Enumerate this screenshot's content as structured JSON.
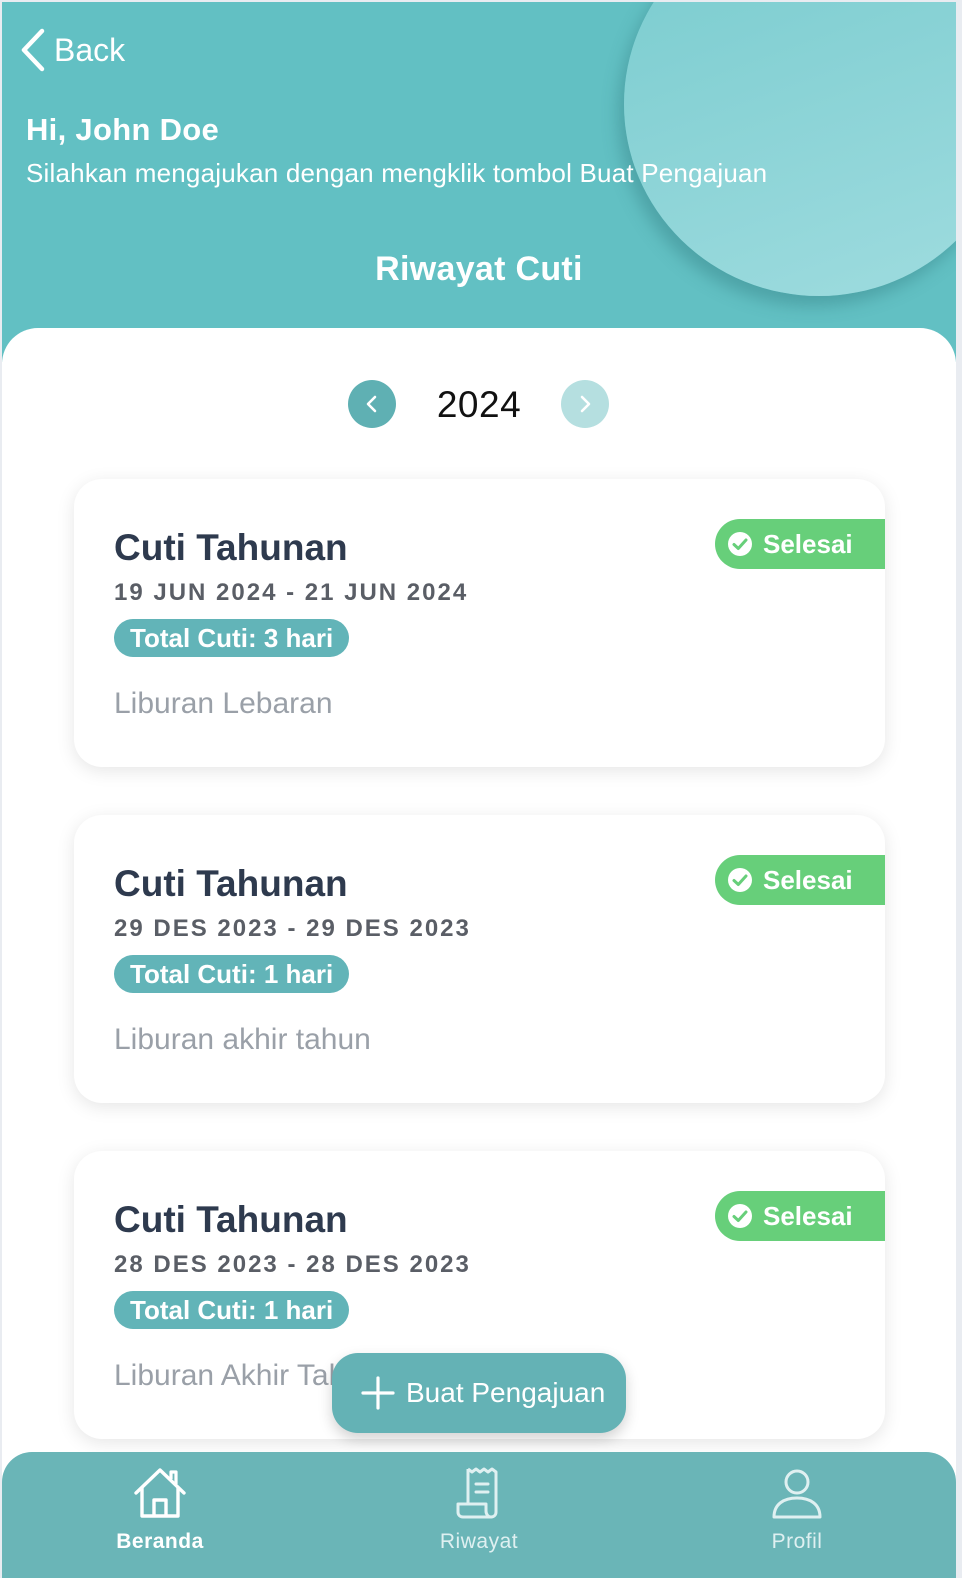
{
  "colors": {
    "header_bg": "#62c0c3",
    "accent": "#62b4b8",
    "status_done": "#67cf7a",
    "tabbar_bg": "#6ab5b7",
    "title_text": "#2e3a4e"
  },
  "header": {
    "back_label": "Back",
    "greeting": "Hi, John Doe",
    "subtitle": "Silahkan mengajukan dengan mengklik tombol Buat Pengajuan",
    "title": "Riwayat Cuti"
  },
  "year_nav": {
    "year": "2024",
    "prev_icon": "chevron-left-icon",
    "next_icon": "chevron-right-icon"
  },
  "leave_history": [
    {
      "title": "Cuti Tahunan",
      "dates": "19 JUN 2024 - 21 JUN 2024",
      "total": "Total Cuti: 3 hari",
      "note": "Liburan Lebaran",
      "status": "Selesai",
      "status_icon": "check-circle-icon"
    },
    {
      "title": "Cuti Tahunan",
      "dates": "29 DES 2023 - 29 DES 2023",
      "total": "Total Cuti: 1 hari",
      "note": "Liburan akhir tahun",
      "status": "Selesai",
      "status_icon": "check-circle-icon"
    },
    {
      "title": "Cuti Tahunan",
      "dates": "28 DES 2023 - 28 DES 2023",
      "total": "Total Cuti: 1 hari",
      "note": "Liburan Akhir Tahun",
      "status": "Selesai",
      "status_icon": "check-circle-icon"
    }
  ],
  "fab": {
    "label": "Buat Pengajuan",
    "icon": "plus-icon"
  },
  "tabbar": {
    "items": [
      {
        "label": "Beranda",
        "icon": "home-icon",
        "active": true
      },
      {
        "label": "Riwayat",
        "icon": "receipt-icon",
        "active": false
      },
      {
        "label": "Profil",
        "icon": "user-icon",
        "active": false
      }
    ]
  }
}
